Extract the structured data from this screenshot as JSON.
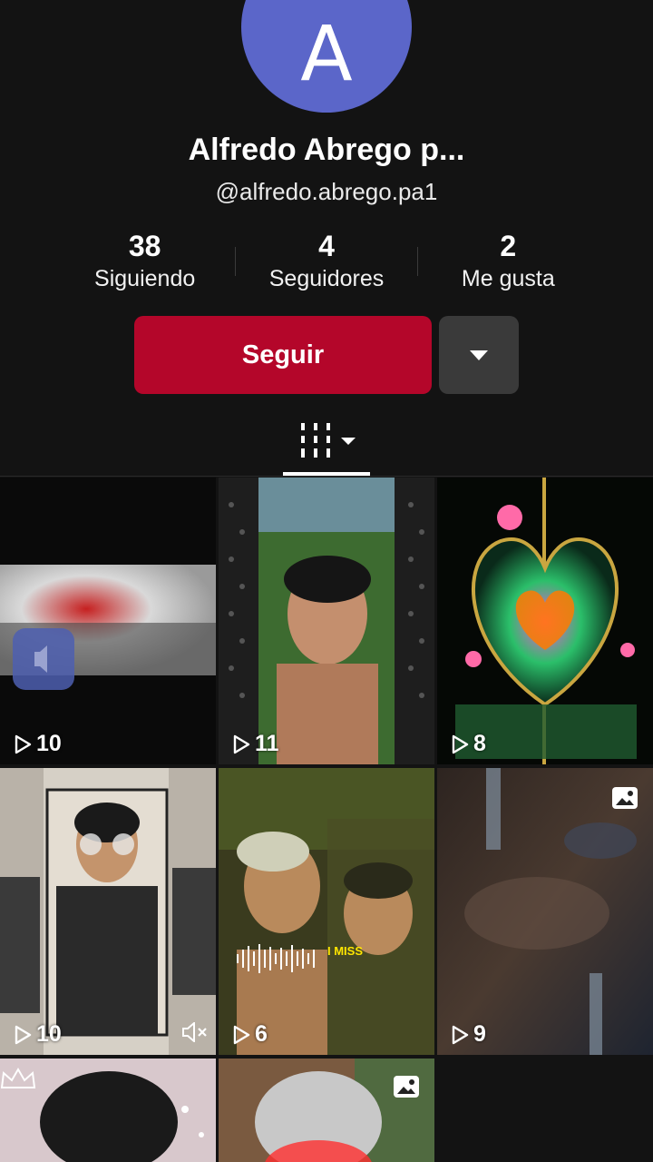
{
  "profile": {
    "avatar_letter": "A",
    "name": "Alfredo Abrego p...",
    "handle": "@alfredo.abrego.pa1",
    "stats": [
      {
        "value": "38",
        "label": "Siguiendo"
      },
      {
        "value": "4",
        "label": "Seguidores"
      },
      {
        "value": "2",
        "label": "Me gusta"
      }
    ],
    "follow_label": "Seguir"
  },
  "colors": {
    "background": "#131313",
    "avatar": "#5b66c9",
    "follow_button": "#b4062a",
    "secondary_button": "#3a3a3a"
  },
  "tabs": {
    "active_icon": "grid-icon"
  },
  "videos": [
    {
      "views": "10",
      "icon": "play-icon"
    },
    {
      "views": "11",
      "icon": "play-icon"
    },
    {
      "views": "8",
      "icon": "play-icon"
    },
    {
      "views": "10",
      "icon": "play-icon",
      "extra": "muted-icon"
    },
    {
      "views": "6",
      "icon": "play-icon"
    },
    {
      "views": "9",
      "icon": "play-icon",
      "extra": "photo-icon"
    },
    {
      "views": "",
      "extra": "crown-icon"
    },
    {
      "views": "",
      "extra": "photo-icon"
    }
  ]
}
